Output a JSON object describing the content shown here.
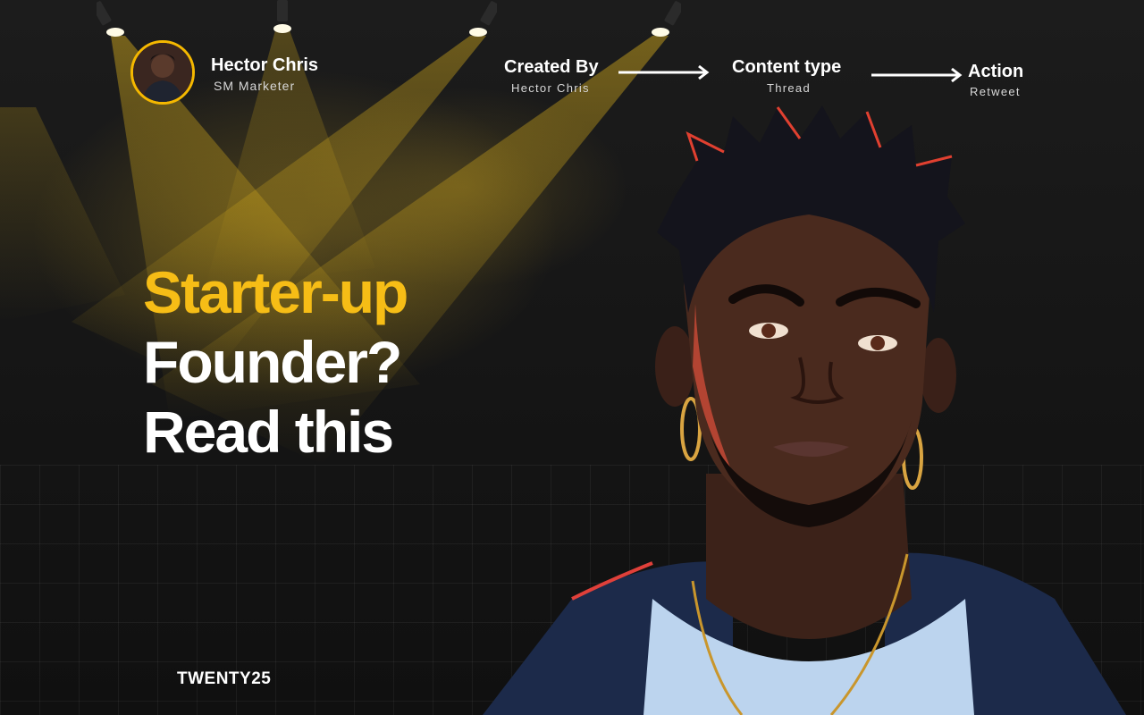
{
  "author": {
    "name": "Hector Chris",
    "role": "SM Marketer"
  },
  "flow": [
    {
      "title": "Created By",
      "subtitle": "Hector Chris"
    },
    {
      "title": "Content type",
      "subtitle": "Thread"
    },
    {
      "title": "Action",
      "subtitle": "Retweet"
    }
  ],
  "headline": {
    "line1": "Starter-up",
    "line2": "Founder?",
    "line3": "Read this"
  },
  "brand": "TWENTY25",
  "colors": {
    "accent": "#f6bd16",
    "background": "#141414",
    "text": "#ffffff"
  },
  "icons": [
    "spotlight-icon",
    "arrow-right-icon"
  ]
}
